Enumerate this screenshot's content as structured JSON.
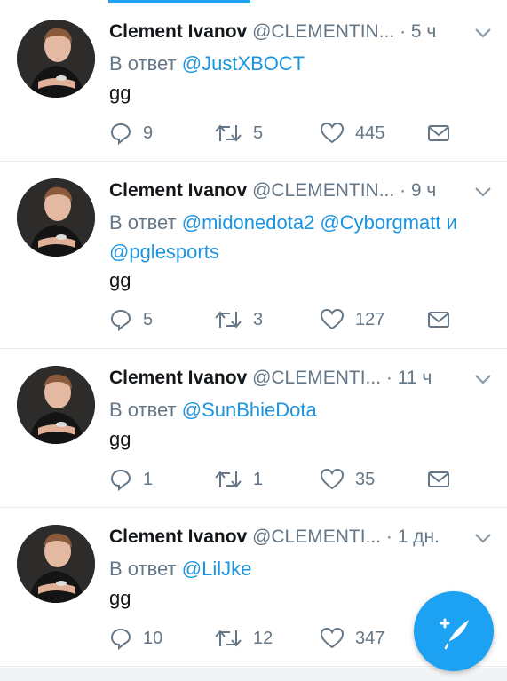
{
  "colors": {
    "accent": "#1da1f2",
    "mention": "#1b95e0",
    "secondary": "#657786",
    "text": "#14171a",
    "divider": "#e6ecf0"
  },
  "icons": {
    "reply": "reply-icon",
    "retweet": "retweet-icon",
    "like": "heart-icon",
    "dm": "envelope-icon",
    "more": "chevron-down-icon",
    "compose": "compose-tweet-icon"
  },
  "tweets": [
    {
      "name": "Clement Ivanov",
      "handle": "@CLEMENTIN...",
      "time": "· 5 ч",
      "reply_prefix": "В ответ",
      "mentions": "@JustXBOCT",
      "text": "gg",
      "replies": "9",
      "retweets": "5",
      "likes": "445"
    },
    {
      "name": "Clement Ivanov",
      "handle": "@CLEMENTIN...",
      "time": "· 9 ч",
      "reply_prefix": "В ответ",
      "mentions": "@midonedota2 @Cyborgmatt и @pglesports",
      "text": "gg",
      "replies": "5",
      "retweets": "3",
      "likes": "127"
    },
    {
      "name": "Clement Ivanov",
      "handle": "@CLEMENTI...",
      "time": "· 11 ч",
      "reply_prefix": "В ответ",
      "mentions": "@SunBhieDota",
      "text": "gg",
      "replies": "1",
      "retweets": "1",
      "likes": "35"
    },
    {
      "name": "Clement Ivanov",
      "handle": "@CLEMENTI...",
      "time": "· 1 дн.",
      "reply_prefix": "В ответ",
      "mentions": "@LilJke",
      "text": "gg",
      "replies": "10",
      "retweets": "12",
      "likes": "347"
    }
  ]
}
